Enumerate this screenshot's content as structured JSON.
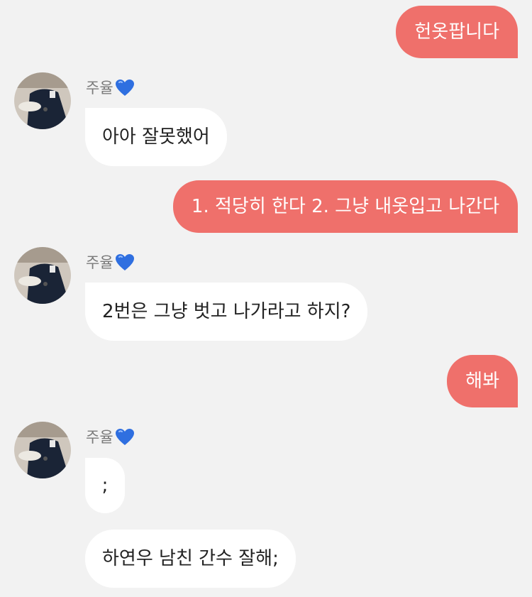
{
  "chat": {
    "contact_name": "주율",
    "accent_color": "#ef706b",
    "heart_color": "#2f6fe0",
    "messages": [
      {
        "from": "me",
        "text": "헌옷팝니다"
      },
      {
        "from": "them",
        "text": "아아 잘못했어"
      },
      {
        "from": "me",
        "text": "1. 적당히 한다 2. 그냥 내옷입고 나간다"
      },
      {
        "from": "them",
        "text": "2번은 그냥 벗고 나가라고 하지?"
      },
      {
        "from": "me",
        "text": "해봐"
      },
      {
        "from": "them",
        "text": ";"
      },
      {
        "from": "them",
        "text": "하연우 남친 간수 잘해;"
      }
    ]
  }
}
